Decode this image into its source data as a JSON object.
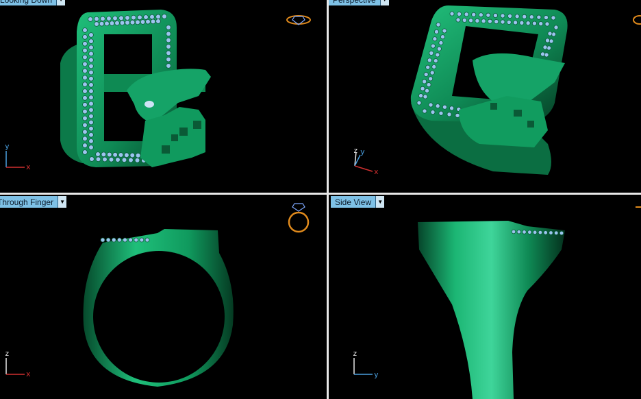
{
  "viewports": {
    "top_left": {
      "label": "Looking Down",
      "axes": [
        "y",
        "x"
      ]
    },
    "top_right": {
      "label": "Perspective",
      "axes": [
        "z",
        "y",
        "x"
      ]
    },
    "bottom_left": {
      "label": "Through Finger",
      "axes": [
        "z",
        "x"
      ]
    },
    "bottom_right": {
      "label": "Side View",
      "axes": [
        "z",
        "y"
      ]
    }
  },
  "colors": {
    "metal": "#11a064",
    "gem": "#8fb8e8",
    "background": "#000000",
    "tab_active": "#7ec1e6",
    "axis_x": "#d23030",
    "axis_y": "#4aa0e0",
    "axis_z": "#e8e8e8",
    "divider": "#e8e8e8"
  },
  "icons": {
    "top_left": "ring-view-icon",
    "top_right": "ring-view-icon",
    "bottom_left": "ring-view-icon",
    "bottom_right": "ring-view-icon"
  }
}
